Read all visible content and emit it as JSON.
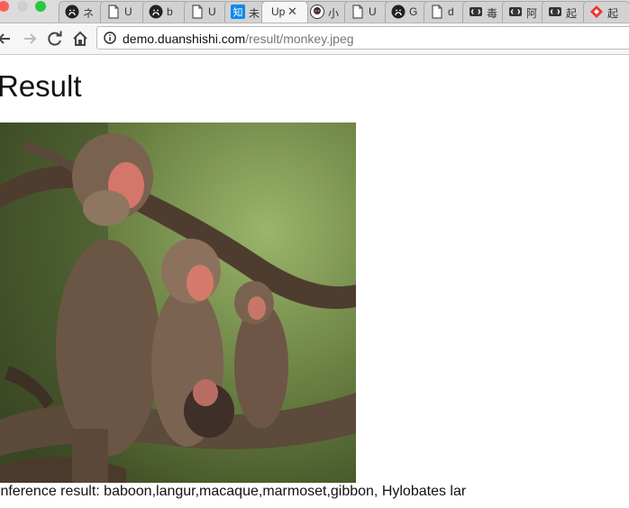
{
  "browser": {
    "tabs": [
      {
        "label": "ネ",
        "icon": "github-icon"
      },
      {
        "label": "U",
        "icon": "page-icon"
      },
      {
        "label": "b",
        "icon": "github-icon"
      },
      {
        "label": "U",
        "icon": "page-icon"
      },
      {
        "label": "未",
        "icon": "zhihu-icon",
        "icon_text": "知"
      },
      {
        "label": "Up",
        "icon": "none",
        "active": true
      },
      {
        "label": "小",
        "icon": "octocat-icon"
      },
      {
        "label": "U",
        "icon": "page-icon"
      },
      {
        "label": "G",
        "icon": "github-icon"
      },
      {
        "label": "d",
        "icon": "page-icon"
      },
      {
        "label": "毒",
        "icon": "bracket-icon"
      },
      {
        "label": "阿",
        "icon": "bracket-icon"
      },
      {
        "label": "起",
        "icon": "bracket-icon"
      },
      {
        "label": "起",
        "icon": "red-diamond-icon"
      }
    ],
    "close_glyph": "✕",
    "url_host": "demo.duanshishi.com",
    "url_path": "/result/monkey.jpeg"
  },
  "page": {
    "title": "Result",
    "image_subject": "monkey family on a tree branch",
    "inference_text": "Inference result: baboon,langur,macaque,marmoset,gibbon, Hylobates lar"
  },
  "colors": {
    "traffic_close": "#fd5f57",
    "traffic_min": "#febc2e",
    "traffic_max": "#27c840"
  }
}
